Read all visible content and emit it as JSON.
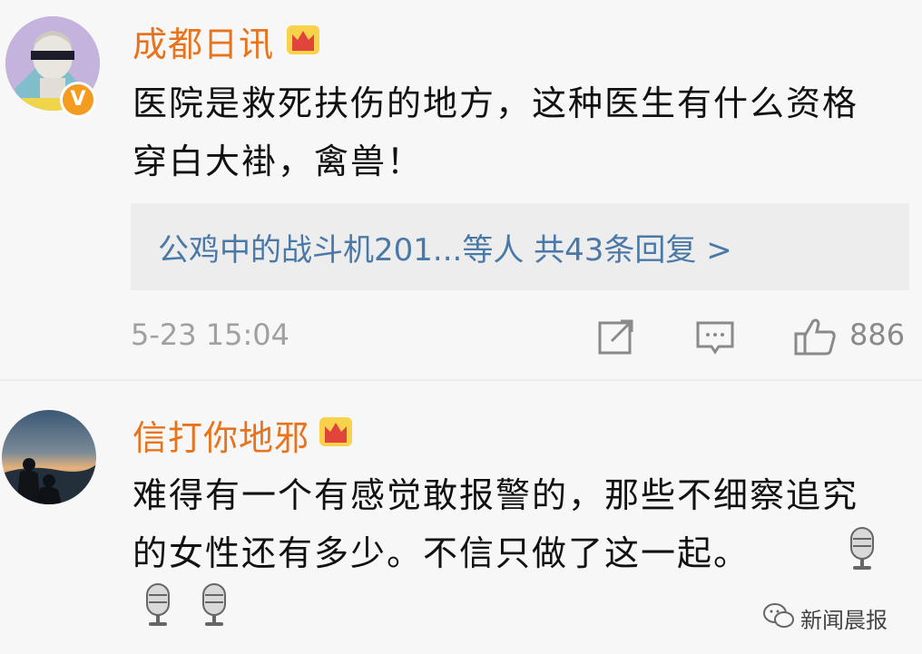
{
  "comments": [
    {
      "username": "成都日讯",
      "verified_badge": "V",
      "content": "医院是救死扶伤的地方，这种医生有什么资格穿白大褂，禽兽！",
      "replies_summary": "公鸡中的战斗机201...等人  共43条回复 >",
      "time": "5-23 15:04",
      "likes": "886",
      "icons": [
        "crown-icon",
        "share-icon",
        "comment-icon",
        "thumbs-up-icon"
      ]
    },
    {
      "username": "信打你地邪",
      "content": "难得有一个有感觉敢报警的，那些不细察追究的女性还有多少。不信只做了这一起。",
      "icons": [
        "crown-icon",
        "microphone-icon",
        "microphone-icon",
        "microphone-icon"
      ]
    }
  ],
  "watermark": {
    "text": "新闻晨报",
    "icon": "wechat-icon"
  },
  "colors": {
    "username": "#e8731c",
    "link": "#4a79a8",
    "meta": "#a0a0a0",
    "badge": "#f39c1f"
  }
}
